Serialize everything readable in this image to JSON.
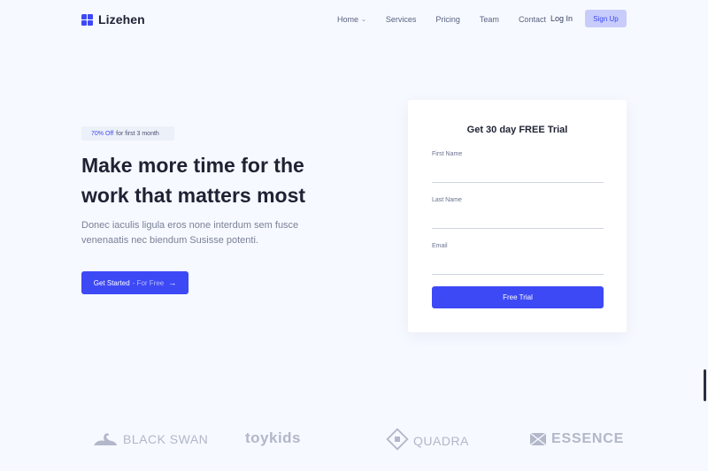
{
  "brand": {
    "name": "Lizehen",
    "accent_color": "#3d49f5"
  },
  "nav": {
    "items": [
      {
        "label": "Home",
        "has_dropdown": true
      },
      {
        "label": "Services"
      },
      {
        "label": "Pricing"
      },
      {
        "label": "Team"
      },
      {
        "label": "Contact"
      }
    ],
    "login_label": "Log In",
    "signup_label": "Sign Up"
  },
  "hero": {
    "badge_accent": "70% Off",
    "badge_text": "for first 3 month",
    "headline_line1": "Make more time for the",
    "headline_line2": "work that matters most",
    "subtext_line1": "Donec iaculis ligula eros none interdum sem fusce",
    "subtext_line2": "venenaatis nec biendum Susisse potenti.",
    "cta_label": "Get Started",
    "cta_sub": "- For Free",
    "cta_icon": "arrow-right-icon"
  },
  "form": {
    "title": "Get 30 day FREE Trial",
    "fields": [
      {
        "label": "First Name",
        "value": ""
      },
      {
        "label": "Last Name",
        "value": ""
      },
      {
        "label": "Email",
        "value": ""
      }
    ],
    "submit_label": "Free Trial"
  },
  "partners": [
    {
      "name": "BLACK SWAN",
      "icon": "swan-icon"
    },
    {
      "name": "toykids"
    },
    {
      "name": "QUADRA",
      "icon": "diamond-icon"
    },
    {
      "name": "ESSENCE",
      "icon": "envelope-icon"
    }
  ]
}
